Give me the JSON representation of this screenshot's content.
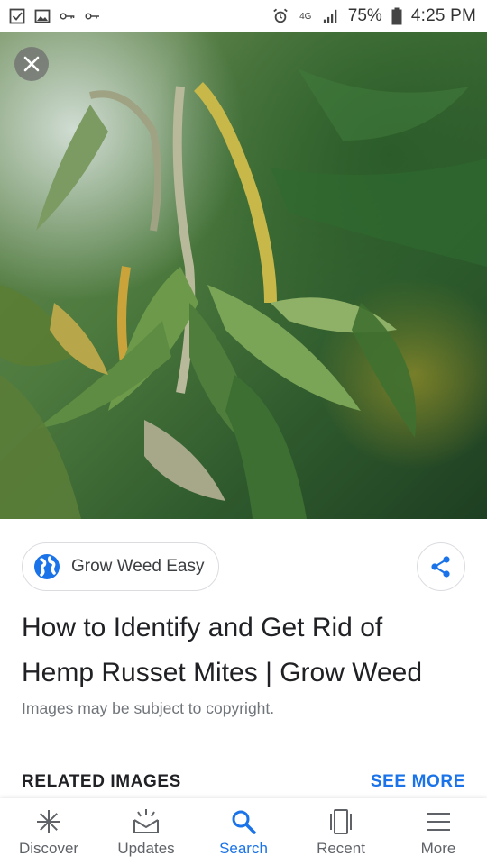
{
  "status_bar": {
    "battery": "75%",
    "time": "4:25 PM",
    "network": "4G",
    "icons": [
      "checkbox-icon",
      "image-icon",
      "key-icon",
      "key-small-icon",
      "alarm-icon",
      "signal-icon",
      "battery-icon"
    ]
  },
  "hero": {
    "close_icon": "close-icon"
  },
  "source": {
    "name": "Grow Weed Easy",
    "icon": "globe-icon"
  },
  "share": {
    "icon": "share-icon"
  },
  "title_line1": "How to Identify and Get Rid of",
  "title_line2": "Hemp Russet Mites | Grow Weed",
  "copyright_note": "Images may be subject to copyright.",
  "related": {
    "header": "RELATED IMAGES",
    "see_more": "SEE MORE"
  },
  "nav": {
    "items": [
      {
        "label": "Discover",
        "icon": "discover-icon",
        "active": false
      },
      {
        "label": "Updates",
        "icon": "updates-icon",
        "active": false
      },
      {
        "label": "Search",
        "icon": "search-icon",
        "active": true
      },
      {
        "label": "Recent",
        "icon": "recent-icon",
        "active": false
      },
      {
        "label": "More",
        "icon": "menu-icon",
        "active": false
      }
    ]
  },
  "colors": {
    "accent": "#1a73e8",
    "text_primary": "#202124",
    "text_secondary": "#70757a"
  }
}
